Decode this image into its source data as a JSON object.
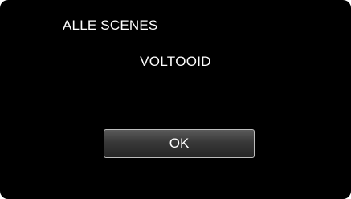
{
  "screen": {
    "title": "ALLE SCENES",
    "status_message": "VOLTOOID",
    "ok_label": "OK"
  },
  "colors": {
    "background": "#000000",
    "text": "#ffffff",
    "button_border": "#bdbdbd",
    "button_fill": "#383838"
  }
}
